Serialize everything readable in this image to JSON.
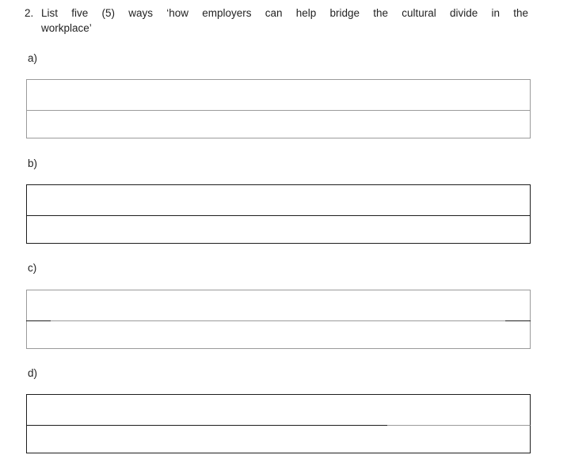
{
  "document": {
    "page_background": "#ffffff",
    "text_color": "#232323",
    "rule_color_light": "#9b9b9b",
    "rule_color_dark": "#1e1e1e"
  },
  "question": {
    "number": "2.",
    "line1": "List five (5) ways ‘how employers can help bridge the cultural divide in the",
    "line2": "workplace’",
    "full_text": "2. List five (5) ways ‘how employers can help bridge the cultural divide in the workplace’"
  },
  "answers": [
    {
      "label": "a)",
      "rows": [
        "",
        ""
      ]
    },
    {
      "label": "b)",
      "rows": [
        "",
        ""
      ]
    },
    {
      "label": "c)",
      "rows": [
        "",
        ""
      ]
    },
    {
      "label": "d)",
      "rows": [
        "",
        ""
      ]
    }
  ]
}
